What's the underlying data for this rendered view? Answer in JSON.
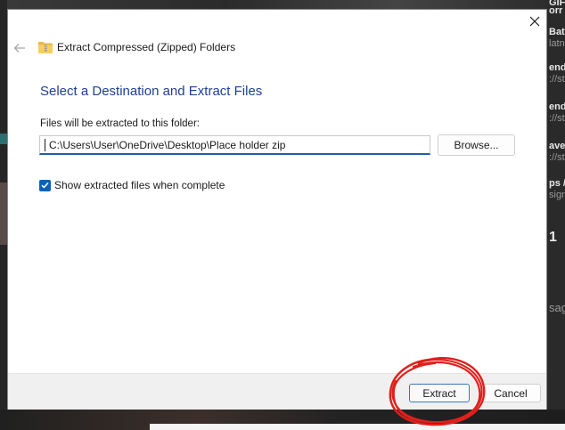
{
  "background": {
    "right_fragments": [
      {
        "text": "GIF",
        "dim": false
      },
      {
        "text": "orr",
        "dim": false
      },
      {
        "text": "Bat",
        "dim": false
      },
      {
        "text": "latn",
        "dim": true
      },
      {
        "text": "end",
        "dim": false
      },
      {
        "text": "://st",
        "dim": true
      },
      {
        "text": "end",
        "dim": false
      },
      {
        "text": "://st",
        "dim": true
      },
      {
        "text": "ave",
        "dim": false
      },
      {
        "text": "://st",
        "dim": true
      },
      {
        "text": "ps /",
        "dim": false
      },
      {
        "text": "sign",
        "dim": true
      },
      {
        "text": "1",
        "dim": false
      },
      {
        "text": "sag",
        "dim": true
      }
    ]
  },
  "dialog": {
    "title": "Extract Compressed (Zipped) Folders",
    "heading": "Select a Destination and Extract Files",
    "field_label": "Files will be extracted to this folder:",
    "path_value": "C:\\Users\\User\\OneDrive\\Desktop\\Place holder zip",
    "browse_label": "Browse...",
    "checkbox_label": "Show extracted files when complete",
    "checkbox_checked": true,
    "extract_label": "Extract",
    "cancel_label": "Cancel"
  },
  "icons": {
    "back": "back-arrow-icon",
    "folder": "zip-folder-icon",
    "close": "close-icon",
    "check": "checkmark-icon"
  },
  "colors": {
    "heading_blue": "#1f3f93",
    "accent_blue": "#0b62b4",
    "annotation_red": "#e0201b"
  }
}
